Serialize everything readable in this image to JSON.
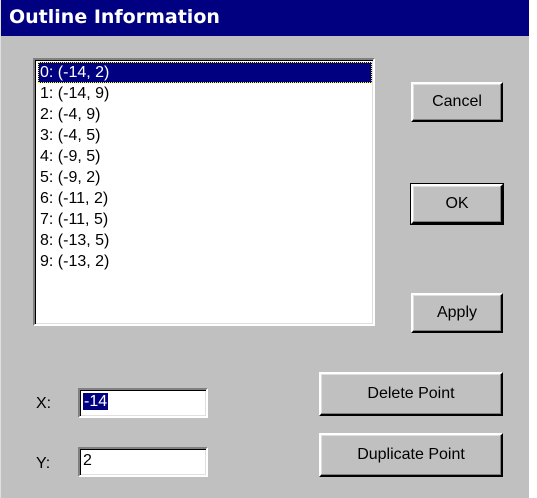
{
  "window": {
    "title": "Outline Information"
  },
  "points_list": {
    "selected_index": 0,
    "items": [
      "0: (-14, 2)",
      "1: (-14, 9)",
      "2: (-4, 9)",
      "3: (-4, 5)",
      "4: (-9, 5)",
      "5: (-9, 2)",
      "6: (-11, 2)",
      "7: (-11, 5)",
      "8: (-13, 5)",
      "9: (-13, 2)"
    ]
  },
  "buttons": {
    "cancel": "Cancel",
    "ok": "OK",
    "apply": "Apply",
    "delete_point": "Delete Point",
    "duplicate_point": "Duplicate Point"
  },
  "fields": {
    "x_label": "X:",
    "x_value": "-14",
    "y_label": "Y:",
    "y_value": "2"
  },
  "colors": {
    "dialog_face": "#c0c0c0",
    "title_bar": "#000080",
    "selection": "#000080",
    "selection_text": "#ffffff"
  }
}
